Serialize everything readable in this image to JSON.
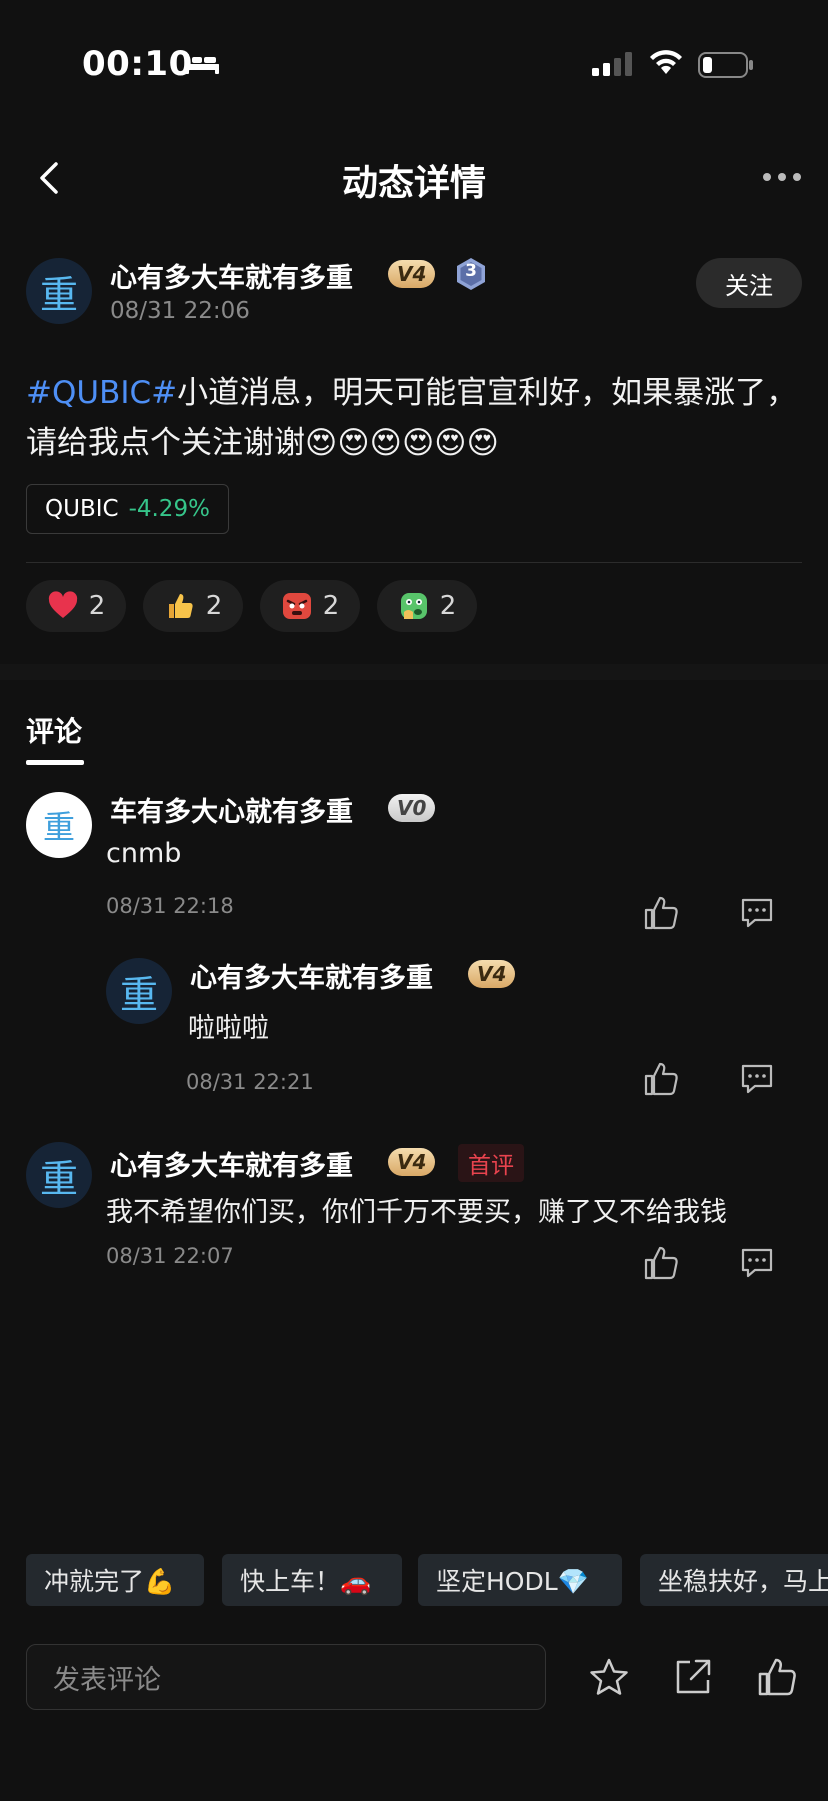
{
  "status_bar": {
    "time": "00:10"
  },
  "nav": {
    "title": "动态详情"
  },
  "post": {
    "author": {
      "avatar_char": "重",
      "name": "心有多大车就有多重",
      "vip_badge": "V4",
      "level": "3",
      "time": "08/31 22:06"
    },
    "follow_label": "关注",
    "hashtag": "#QUBIC#",
    "body": "小道消息，明天可能官宣利好，如果暴涨了，请给我点个关注谢谢😍😍😍😍😍😍",
    "ticker": {
      "symbol": "QUBIC",
      "change": "-4.29%",
      "change_color": "#36c58a"
    },
    "reactions": [
      {
        "icon": "heart-icon",
        "count": "2"
      },
      {
        "icon": "thumbs-up-emoji-icon",
        "count": "2"
      },
      {
        "icon": "angry-face-icon",
        "count": "2"
      },
      {
        "icon": "sick-face-icon",
        "count": "2"
      }
    ]
  },
  "comments_tab": "评论",
  "comments": [
    {
      "avatar_char": "重",
      "name": "车有多大心就有多重",
      "badge": "V0",
      "text": "cnmb",
      "time": "08/31 22:18"
    },
    {
      "avatar_char": "重",
      "name": "心有多大车就有多重",
      "badge": "V4",
      "text": "啦啦啦",
      "time": "08/31 22:21"
    },
    {
      "avatar_char": "重",
      "name": "心有多大车就有多重",
      "badge": "V4",
      "first_tag": "首评",
      "text": "我不希望你们买，你们千万不要买，赚了又不给我钱",
      "time": "08/31 22:07"
    }
  ],
  "quick_replies": [
    "冲就完了💪",
    "快上车！🚗",
    "坚定HODL💎",
    "坐稳扶好，马上"
  ],
  "bottom": {
    "input_placeholder": "发表评论"
  },
  "colors": {
    "background": "#111111",
    "hashtag": "#4e8ff5",
    "first_tag": "#e8434e",
    "vip_gold": "#d9a866"
  }
}
